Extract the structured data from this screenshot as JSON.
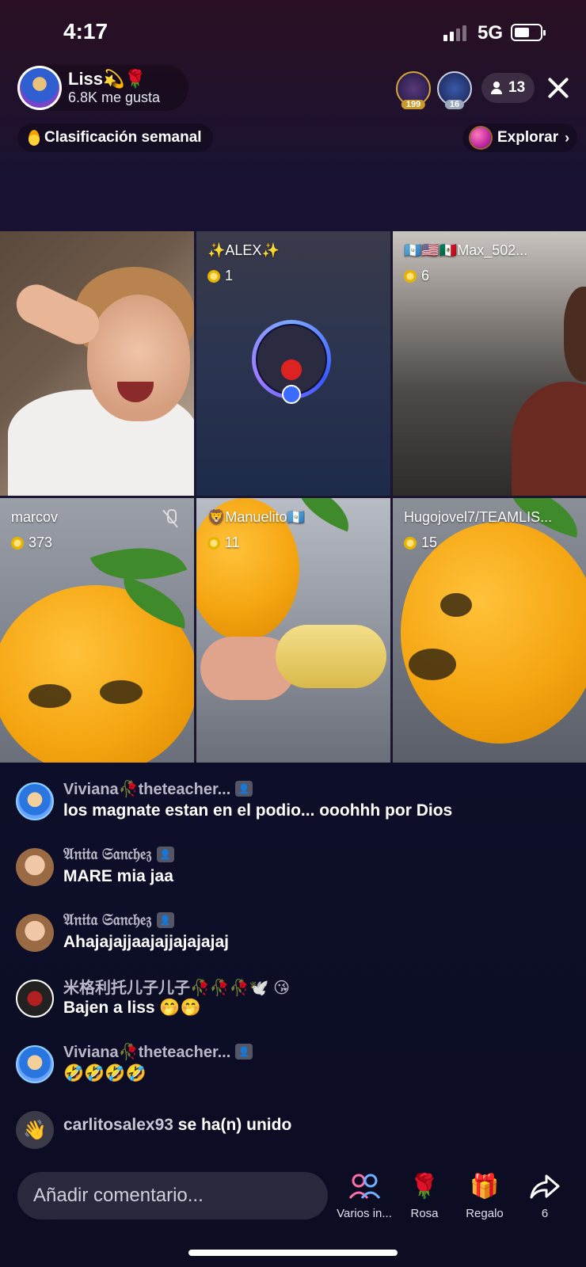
{
  "status_bar": {
    "time": "4:17",
    "network": "5G"
  },
  "host": {
    "name": "Liss💫🌹",
    "likes": "6.8K me gusta"
  },
  "top_viewers": [
    {
      "badge": "199"
    },
    {
      "badge": "16"
    }
  ],
  "viewer_count": "13",
  "weekly_ranking": "Clasificación semanal",
  "explore": "Explorar",
  "tiles": [
    {
      "name": "",
      "coins": ""
    },
    {
      "name": "✨ALEX✨",
      "coins": "1"
    },
    {
      "name": "🇬🇹🇺🇸🇲🇽Max_502...",
      "coins": "6"
    },
    {
      "name": "marcov",
      "coins": "373",
      "muted": true
    },
    {
      "name": "🦁Manuelito🇬🇹",
      "coins": "11"
    },
    {
      "name": "Hugojovel7/TEAMLIS...",
      "coins": "15"
    }
  ],
  "chat": [
    {
      "user": "Viviana🥀theteacher...",
      "text": "los  magnate  estan en el podio... ooohhh por  Dios"
    },
    {
      "user": "𝔄𝔫𝔦𝔱𝔞 𝔖𝔞𝔫𝔠𝔥𝔢𝔷",
      "text": "MARE mia jaa"
    },
    {
      "user": "𝔄𝔫𝔦𝔱𝔞 𝔖𝔞𝔫𝔠𝔥𝔢𝔷",
      "text": "Ahajajajjaajajjajajajaj"
    },
    {
      "user": "米格利托儿子儿子🥀🥀🥀🕊️ 😘",
      "text": "Bajen a liss 🤭🤭"
    },
    {
      "user": "Viviana🥀theteacher...",
      "text": "🤣🤣🤣🤣"
    }
  ],
  "join_notice": {
    "user": "carlitosalex93",
    "text": "se ha(n) unido"
  },
  "comment_placeholder": "Añadir comentario...",
  "actions": [
    {
      "label": "Varios in...",
      "icon": "multi-guest-icon"
    },
    {
      "label": "Rosa",
      "icon": "rose-icon"
    },
    {
      "label": "Regalo",
      "icon": "gift-icon"
    },
    {
      "label": "6",
      "icon": "share-icon"
    }
  ]
}
